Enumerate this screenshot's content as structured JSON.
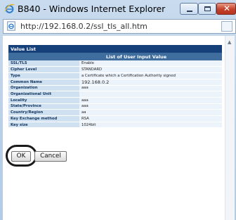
{
  "window": {
    "title": "B840 - Windows Internet Explorer"
  },
  "address": {
    "url": "http://192.168.0.2/ssl_tls_all.htm"
  },
  "panel": {
    "title": "Value List",
    "table_header": "List of User Input Value",
    "rows": [
      {
        "label": "SSL/TLS",
        "value": "Enable"
      },
      {
        "label": "Cipher Level",
        "value": "STANDARD"
      },
      {
        "label": "Type",
        "value": "a Certificate which a Certification Authority signed"
      },
      {
        "label": "Common Name",
        "value": "192.168.0.2"
      },
      {
        "label": "Organization",
        "value": "aaa"
      },
      {
        "label": "Organizational Unit",
        "value": ""
      },
      {
        "label": "Locality",
        "value": "aaa"
      },
      {
        "label": "State/Province",
        "value": "aaa"
      },
      {
        "label": "Country/Region",
        "value": "aa"
      },
      {
        "label": "Key Exchange method",
        "value": "RSA"
      },
      {
        "label": "Key size",
        "value": "1024bit"
      }
    ]
  },
  "buttons": {
    "ok": "OK",
    "cancel": "Cancel"
  },
  "colors": {
    "header_dark": "#16407a",
    "header_mid": "#3e6d9e",
    "label_bg": "#cfe0f0",
    "value_bg": "#edf3fa",
    "close": "#c4412b"
  },
  "icons": [
    "ie-logo-icon",
    "page-icon",
    "minimize-icon",
    "maximize-icon",
    "close-icon",
    "scroll-up-arrow-icon"
  ]
}
